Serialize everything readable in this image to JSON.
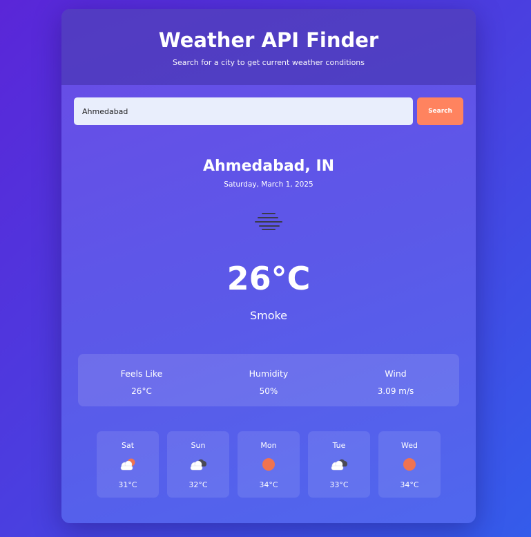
{
  "header": {
    "title": "Weather API Finder",
    "subtitle": "Search for a city to get current weather conditions"
  },
  "search": {
    "value": "Ahmedabad",
    "button_label": "Search"
  },
  "current": {
    "city": "Ahmedabad, IN",
    "date": "Saturday, March 1, 2025",
    "icon": "smoke-icon",
    "temperature": "26°C",
    "condition": "Smoke"
  },
  "details": [
    {
      "label": "Feels Like",
      "value": "26°C"
    },
    {
      "label": "Humidity",
      "value": "50%"
    },
    {
      "label": "Wind",
      "value": "3.09 m/s"
    }
  ],
  "forecast": [
    {
      "day": "Sat",
      "icon": "partly-cloudy-sun-icon",
      "temp": "31°C"
    },
    {
      "day": "Sun",
      "icon": "cloudy-icon",
      "temp": "32°C"
    },
    {
      "day": "Mon",
      "icon": "sun-icon",
      "temp": "34°C"
    },
    {
      "day": "Tue",
      "icon": "cloudy-icon",
      "temp": "33°C"
    },
    {
      "day": "Wed",
      "icon": "sun-icon",
      "temp": "34°C"
    }
  ],
  "colors": {
    "accent": "#ff835f",
    "sun": "#f07350",
    "input_bg": "#e9eefc"
  }
}
